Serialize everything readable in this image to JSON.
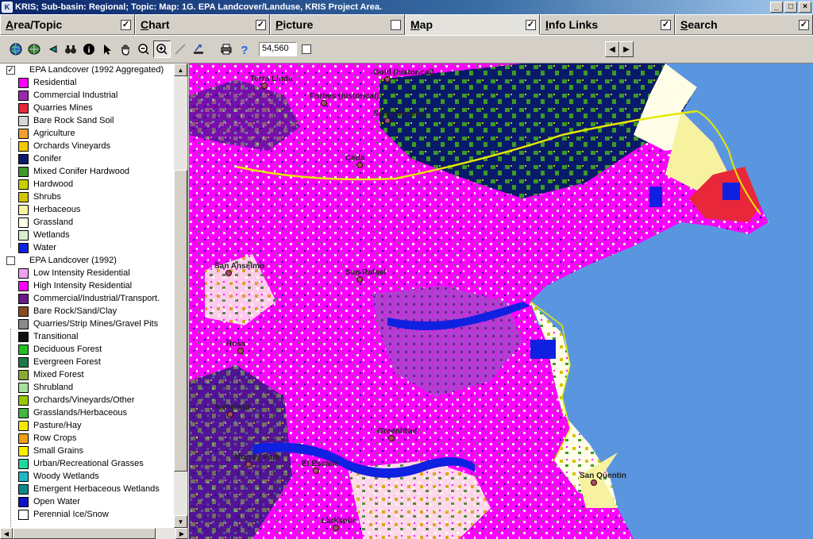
{
  "window": {
    "title": "KRIS; Sub-basin: Regional; Topic:  Map: 1G. EPA Landcover/Landuse, KRIS Project Area.",
    "buttons": [
      "_",
      "□",
      "×"
    ]
  },
  "tabs": [
    {
      "label": "Area/Topic",
      "checked": "✓"
    },
    {
      "label": "Chart",
      "checked": "✓"
    },
    {
      "label": "Picture",
      "checked": ""
    },
    {
      "label": "Map",
      "checked": "✓"
    },
    {
      "label": "Info Links",
      "checked": "✓"
    },
    {
      "label": "Search",
      "checked": "✓"
    }
  ],
  "toolbar": {
    "icons": [
      "globe-icon",
      "layers-icon",
      "back-arrow-icon",
      "binoculars-icon",
      "info-icon",
      "pointer-icon",
      "pan-hand-icon",
      "zoom-out-icon",
      "zoom-in-icon",
      "measure-line-icon",
      "hotlink-icon",
      "print-icon",
      "help-icon"
    ],
    "scale_value": "54,560",
    "nav_left": "◀",
    "nav_right": "▶"
  },
  "legend": {
    "group1": {
      "checked": "✓",
      "title": "EPA Landcover (1992 Aggregated)",
      "items": [
        {
          "label": "Residential",
          "color": "#ff00ff"
        },
        {
          "label": "Commercial Industrial",
          "color": "#9b27b0"
        },
        {
          "label": "Quarries Mines",
          "color": "#e8283a"
        },
        {
          "label": "Bare Rock Sand Soil",
          "color": "#d6d6d6"
        },
        {
          "label": "Agriculture",
          "color": "#f0a030"
        },
        {
          "label": "Orchards Vineyards",
          "color": "#f5c800"
        },
        {
          "label": "Conifer",
          "color": "#0a1a6a"
        },
        {
          "label": "Mixed Conifer Hardwood",
          "color": "#3c9a28"
        },
        {
          "label": "Hardwood",
          "color": "#c8d000"
        },
        {
          "label": "Shrubs",
          "color": "#d4c400"
        },
        {
          "label": "Herbaceous",
          "color": "#f7f2a0"
        },
        {
          "label": "Grassland",
          "color": "#fffde8"
        },
        {
          "label": "Wetlands",
          "color": "#d8f0d0"
        },
        {
          "label": "Water",
          "color": "#1020e0"
        }
      ]
    },
    "group2": {
      "checked": "",
      "title": "EPA Landcover (1992)",
      "items": [
        {
          "label": "Low Intensity Residential",
          "color": "#f0a0f0"
        },
        {
          "label": "High Intensity Residential",
          "color": "#ff00ff"
        },
        {
          "label": "Commercial/Industrial/Transport.",
          "color": "#6a1a8a"
        },
        {
          "label": "Bare Rock/Sand/Clay",
          "color": "#8a4a1a"
        },
        {
          "label": "Quarries/Strip Mines/Gravel Pits",
          "color": "#8a8a8a"
        },
        {
          "label": "Transitional",
          "color": "#101010"
        },
        {
          "label": "Deciduous Forest",
          "color": "#20c020"
        },
        {
          "label": "Evergreen Forest",
          "color": "#1a7a4a"
        },
        {
          "label": "Mixed Forest",
          "color": "#8aaa30"
        },
        {
          "label": "Shrubland",
          "color": "#a8e0a0"
        },
        {
          "label": "Orchards/Vineyards/Other",
          "color": "#9ac800"
        },
        {
          "label": "Grasslands/Herbaceous",
          "color": "#40b840"
        },
        {
          "label": "Pasture/Hay",
          "color": "#f5e800"
        },
        {
          "label": "Row Crops",
          "color": "#f0a010"
        },
        {
          "label": "Small Grains",
          "color": "#f8f000"
        },
        {
          "label": "Urban/Recreational Grasses",
          "color": "#20d8a0"
        },
        {
          "label": "Woody Wetlands",
          "color": "#20b8c8"
        },
        {
          "label": "Emergent Herbaceous Wetlands",
          "color": "#108888"
        },
        {
          "label": "Open Water",
          "color": "#1010c8"
        },
        {
          "label": "Perennial Ice/Snow",
          "color": "#ffffff"
        }
      ]
    }
  },
  "map": {
    "colors": {
      "water": "#5a96e0",
      "residential": "#ff00ff",
      "commercial": "#9b27b0",
      "conifer": "#0a1a6a",
      "mixed": "#3c9a28",
      "herbaceous": "#f7f2a0",
      "grassland": "#fffde8",
      "quarry": "#e8283a",
      "shrubs": "#d4c400",
      "road": "#e8e800"
    },
    "towns": [
      "Terra Linda",
      "Gold (historical)",
      "Forbes (historical)",
      "Santa Venetia",
      "Ceda",
      "San Anselmo",
      "San Rafael",
      "Ross",
      "Kentfield",
      "Greenbrae",
      "Murray Park",
      "Larkspur",
      "San Quentin",
      "El Escalle"
    ]
  }
}
